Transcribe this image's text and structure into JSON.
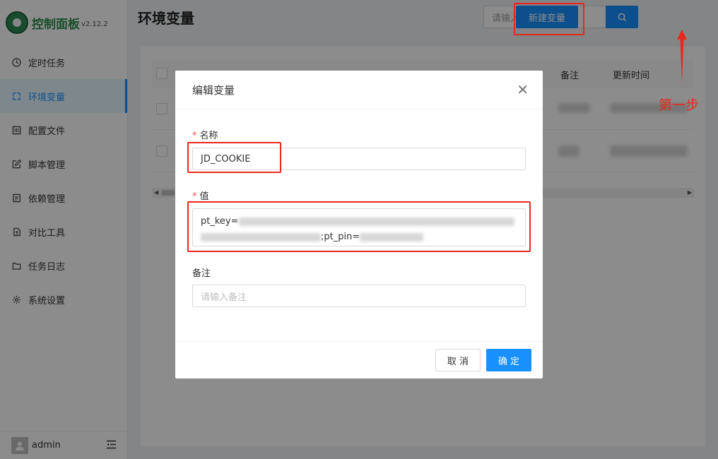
{
  "app": {
    "title": "控制面板",
    "version": "v2.12.2",
    "user": "admin"
  },
  "sidebar": {
    "items": [
      {
        "label": "定时任务",
        "icon": "clock-icon"
      },
      {
        "label": "环境变量",
        "icon": "variable-icon",
        "active": true
      },
      {
        "label": "配置文件",
        "icon": "config-icon"
      },
      {
        "label": "脚本管理",
        "icon": "edit-icon"
      },
      {
        "label": "依赖管理",
        "icon": "package-icon"
      },
      {
        "label": "对比工具",
        "icon": "diff-icon"
      },
      {
        "label": "任务日志",
        "icon": "folder-icon"
      },
      {
        "label": "系统设置",
        "icon": "gear-icon"
      }
    ]
  },
  "header": {
    "page_title": "环境变量",
    "search_placeholder": "请输入名称/值/备注",
    "new_button": "新建变量"
  },
  "table": {
    "columns": [
      "备注",
      "更新时间"
    ]
  },
  "annotation": {
    "step_text": "第一步",
    "accent_color": "#e8281e"
  },
  "modal": {
    "title": "编辑变量",
    "name_label": "名称",
    "name_value": "JD_COOKIE",
    "value_label": "值",
    "value_prefix": "pt_key=",
    "value_pin": ";pt_pin=",
    "remark_label": "备注",
    "remark_placeholder": "请输入备注",
    "cancel_label": "取 消",
    "ok_label": "确 定"
  },
  "colors": {
    "primary": "#1890ff",
    "danger": "#ff4d4f"
  }
}
